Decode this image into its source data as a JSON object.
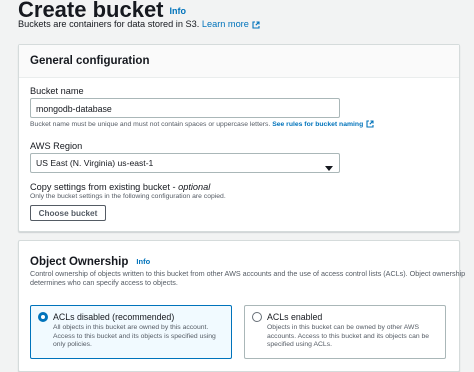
{
  "header": {
    "title": "Create bucket",
    "info": "Info",
    "description": "Buckets are containers for data stored in S3.",
    "learn_more": "Learn more"
  },
  "general": {
    "title": "General configuration",
    "bucket_name_label": "Bucket name",
    "bucket_name_value": "mongodb-database",
    "bucket_name_hint": "Bucket name must be unique and must not contain spaces or uppercase letters.",
    "bucket_name_hint_link": "See rules for bucket naming",
    "region_label": "AWS Region",
    "region_value": "US East (N. Virginia) us-east-1",
    "copy_label": "Copy settings from existing bucket - ",
    "copy_optional": "optional",
    "copy_hint": "Only the bucket settings in the following configuration are copied.",
    "choose_button": "Choose bucket"
  },
  "ownership": {
    "title": "Object Ownership",
    "info": "Info",
    "description_line1": "Control ownership of objects written to this bucket from other AWS accounts and the use of access control lists (ACLs). Object ownership",
    "description_line2": "determines who can specify access to objects.",
    "options": [
      {
        "title": "ACLs disabled (recommended)",
        "desc1": "All objects in this bucket are owned by this account.",
        "desc2": "Access to this bucket and its objects is specified using",
        "desc3": "only policies.",
        "selected": true
      },
      {
        "title": "ACLs enabled",
        "desc1": "Objects in this bucket can be owned by other AWS",
        "desc2": "accounts. Access to this bucket and its objects can be",
        "desc3": "specified using ACLs.",
        "selected": false
      }
    ]
  },
  "colors": {
    "link": "#0073bb",
    "accent": "#0073bb",
    "text": "#16191f",
    "muted": "#545b64",
    "background": "#f2f3f3"
  },
  "icons": {
    "external_link": "external-link-icon",
    "dropdown": "caret-down-icon"
  }
}
